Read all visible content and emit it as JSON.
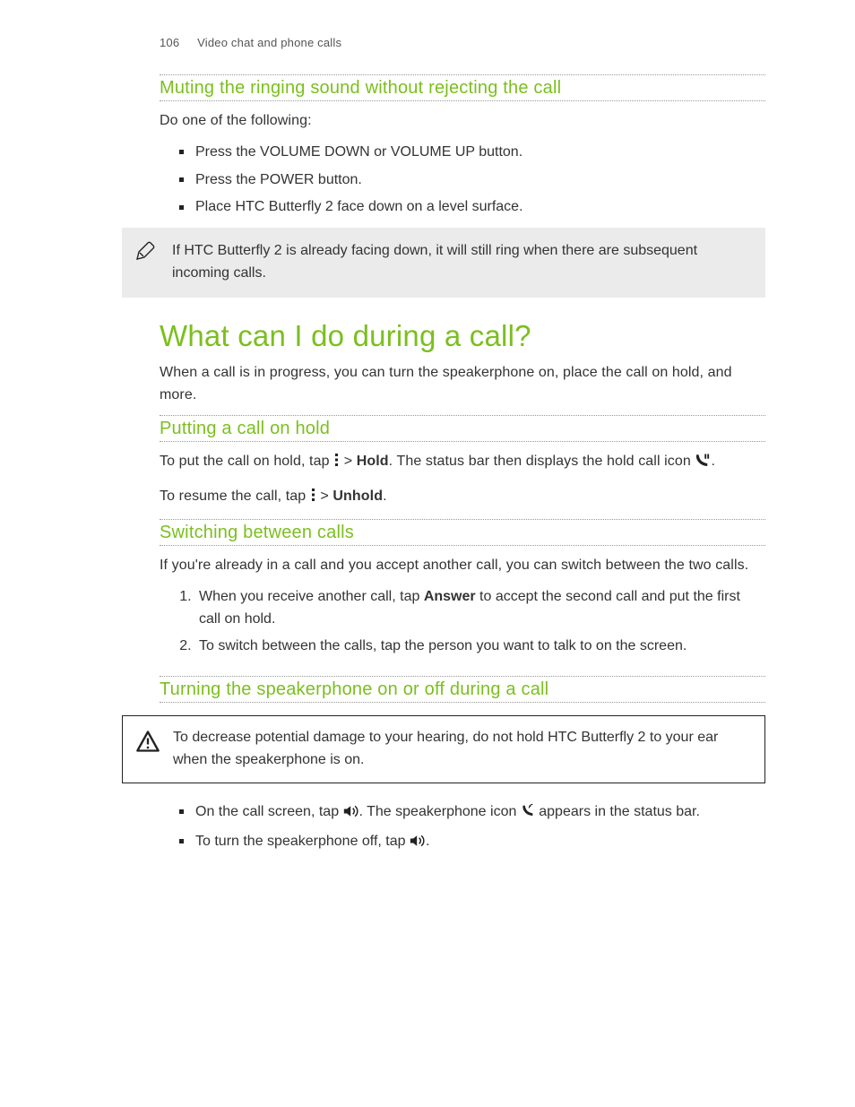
{
  "header": {
    "page_number": "106",
    "section": "Video chat and phone calls"
  },
  "muting": {
    "heading": "Muting the ringing sound without rejecting the call",
    "intro": "Do one of the following:",
    "bullets": [
      "Press the VOLUME DOWN or VOLUME UP button.",
      "Press the POWER button.",
      "Place HTC Butterfly 2 face down on a level surface."
    ],
    "note": "If HTC Butterfly 2 is already facing down, it will still ring when there are subsequent incoming calls."
  },
  "during_call": {
    "heading": "What can I do during a call?",
    "intro": "When a call is in progress, you can turn the speakerphone on, place the call on hold, and more."
  },
  "hold": {
    "heading": "Putting a call on hold",
    "p1_a": "To put the call on hold, tap ",
    "p1_b": " > ",
    "p1_hold": "Hold",
    "p1_c": ". The status bar then displays the hold call icon ",
    "p1_d": ".",
    "p2_a": "To resume the call, tap ",
    "p2_b": " > ",
    "p2_unhold": "Unhold",
    "p2_c": "."
  },
  "switching": {
    "heading": "Switching between calls",
    "intro": "If you're already in a call and you accept another call, you can switch between the two calls.",
    "step1_a": "When you receive another call, tap ",
    "step1_answer": "Answer",
    "step1_b": " to accept the second call and put the first call on hold.",
    "step2": "To switch between the calls, tap the person you want to talk to on the screen."
  },
  "speaker": {
    "heading": "Turning the speakerphone on or off during a call",
    "warning": "To decrease potential damage to your hearing, do not hold HTC Butterfly 2 to your ear when the speakerphone is on.",
    "b1_a": "On the call screen, tap ",
    "b1_b": ". The speakerphone icon ",
    "b1_c": " appears in the status bar.",
    "b2_a": "To turn the speakerphone off, tap ",
    "b2_b": "."
  }
}
